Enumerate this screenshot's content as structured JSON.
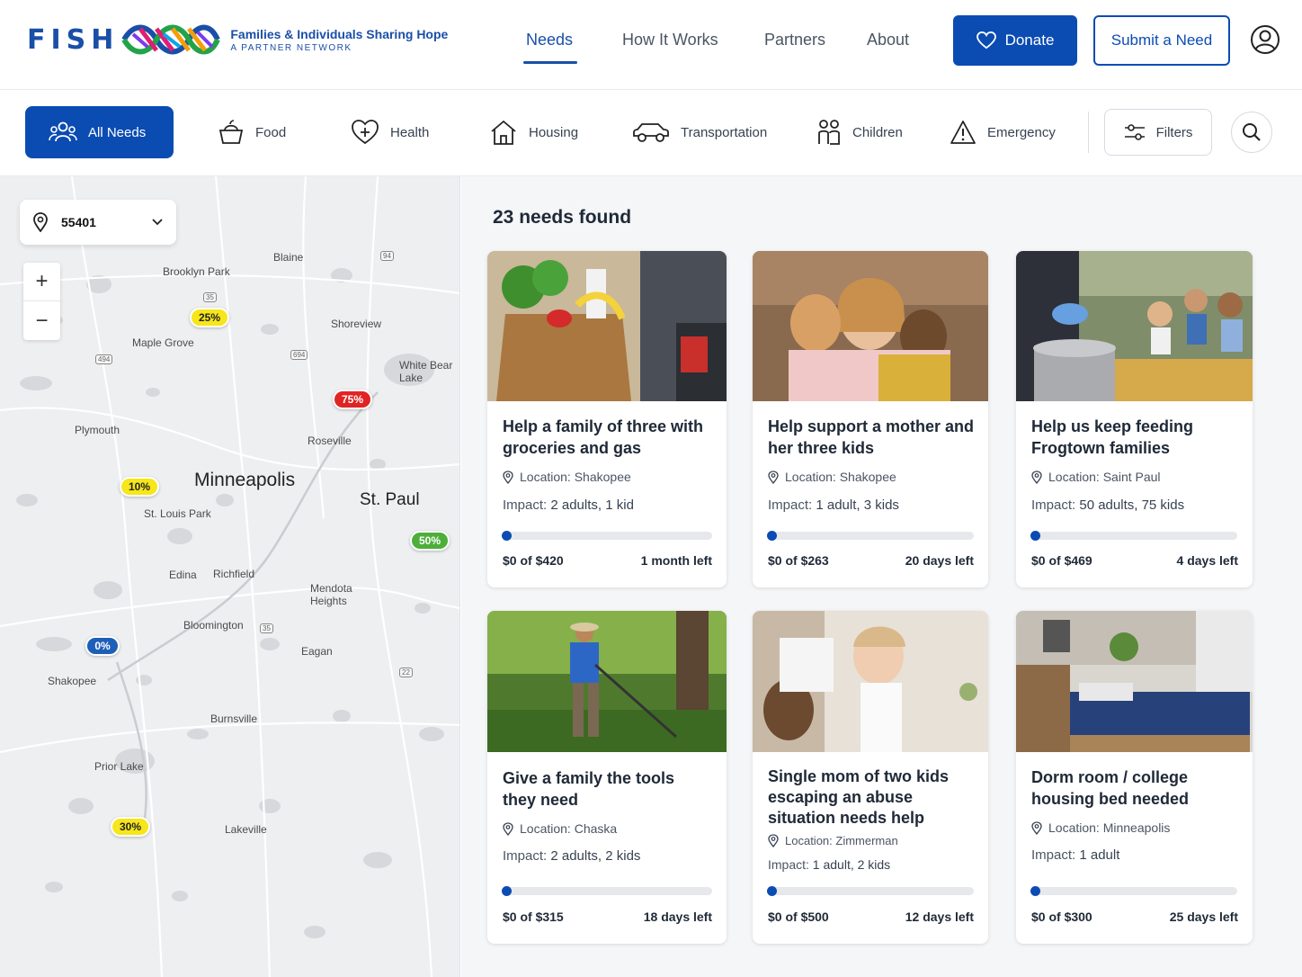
{
  "brand": {
    "wordmark": "FISH",
    "title": "Families & Individuals Sharing Hope",
    "subtitle": "A PARTNER NETWORK"
  },
  "nav": {
    "links": [
      "Needs",
      "How It Works",
      "Partners",
      "About"
    ],
    "active": "Needs",
    "donate_label": "Donate",
    "submit_label": "Submit a Need"
  },
  "categories": [
    {
      "label": "All Needs",
      "icon": "people-icon",
      "active": true
    },
    {
      "label": "Food",
      "icon": "basket-icon"
    },
    {
      "label": "Health",
      "icon": "heart-plus-icon"
    },
    {
      "label": "Housing",
      "icon": "house-icon"
    },
    {
      "label": "Transportation",
      "icon": "car-icon"
    },
    {
      "label": "Children",
      "icon": "children-icon"
    },
    {
      "label": "Emergency",
      "icon": "warning-icon"
    }
  ],
  "filters_label": "Filters",
  "map": {
    "zip": "55401",
    "zoom_in": "+",
    "zoom_out": "−",
    "places": [
      "Blaine",
      "Brooklyn Park",
      "Shoreview",
      "Maple Grove",
      "White Bear Lake",
      "Plymouth",
      "Roseville",
      "Minneapolis",
      "St. Paul",
      "St. Louis Park",
      "Edina",
      "Richfield",
      "Mendota Heights",
      "Bloomington",
      "Eagan",
      "Shakopee",
      "Burnsville",
      "Prior Lake",
      "Lakeville"
    ],
    "markers": [
      {
        "label": "25%",
        "color": "#f6e61a"
      },
      {
        "label": "75%",
        "color": "#e02424"
      },
      {
        "label": "10%",
        "color": "#f6e61a"
      },
      {
        "label": "50%",
        "color": "#4caf3a"
      },
      {
        "label": "0%",
        "color": "#1d5fb8"
      },
      {
        "label": "30%",
        "color": "#f6e61a"
      }
    ],
    "shields": [
      "94",
      "494",
      "694",
      "35",
      "35",
      "22"
    ]
  },
  "results": {
    "count_text": "23 needs found"
  },
  "needs": [
    {
      "title": "Help a family of three with groceries and gas",
      "location": "Location: Shakopee",
      "impact_label": "Impact:",
      "impact": "2 adults, 1 kid",
      "progress": 0,
      "amount": "$0 of $420",
      "time_left": "1 month left"
    },
    {
      "title": "Help support a mother and her three kids",
      "location": "Location: Shakopee",
      "impact_label": "Impact:",
      "impact": "1 adult, 3 kids",
      "progress": 0,
      "amount": "$0 of $263",
      "time_left": "20 days left"
    },
    {
      "title": "Help us keep feeding Frogtown families",
      "location": "Location: Saint Paul",
      "impact_label": "Impact:",
      "impact": "50 adults, 75 kids",
      "progress": 0,
      "amount": "$0 of $469",
      "time_left": "4 days left"
    },
    {
      "title": "Give a family the tools they need",
      "location": "Location: Chaska",
      "impact_label": "Impact:",
      "impact": "2 adults, 2 kids",
      "progress": 0,
      "amount": "$0 of $315",
      "time_left": "18 days left"
    },
    {
      "title": "Single mom of two kids escaping an abuse situation needs help",
      "location": "Location: Zimmerman",
      "impact_label": "Impact:",
      "impact": "1 adult, 2 kids",
      "progress": 0,
      "amount": "$0 of $500",
      "time_left": "12 days left"
    },
    {
      "title": "Dorm room / college housing bed needed",
      "location": "Location: Minneapolis",
      "impact_label": "Impact:",
      "impact": "1 adult",
      "progress": 0,
      "amount": "$0 of $300",
      "time_left": "25 days left"
    }
  ]
}
